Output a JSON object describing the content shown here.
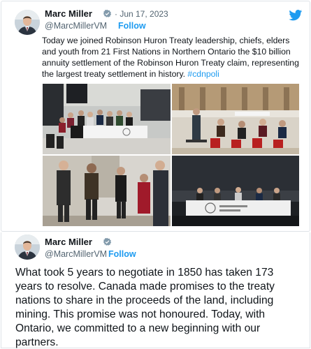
{
  "tweet1": {
    "author_name": "Marc Miller",
    "verified_icon": "verified-badge-icon",
    "date": "· Jun 17, 2023",
    "handle": "@MarcMillerVM",
    "follow_label": "Follow",
    "platform_icon": "twitter-bird-icon",
    "text": "Today we joined Robinson Huron Treaty leadership, chiefs, elders and youth from 21 First Nations in Northern Ontario the $10 billion annuity settlement of the Robinson Huron Treaty claim, representing the largest treaty settlement in history. ",
    "hashtag": "#cdnpoli",
    "photos": [
      "event-photo-panel-table",
      "event-photo-audience",
      "event-photo-group-standing",
      "event-photo-stage-panel"
    ]
  },
  "tweet2": {
    "author_name": "Marc Miller",
    "verified_icon": "verified-badge-icon",
    "handle": "@MarcMillerVM",
    "follow_label": "Follow",
    "text": "What took 5 years to negotiate in 1850 has taken 173 years to resolve. Canada made promises to the treaty nations to share in the proceeds of the land, including mining. This promise was not honoured.  Today, with Ontario, we committed to a new beginning with our partners."
  },
  "colors": {
    "accent": "#1d9bf0",
    "text": "#0f1419",
    "secondary_text": "#536471",
    "border": "#dfe3e8"
  }
}
